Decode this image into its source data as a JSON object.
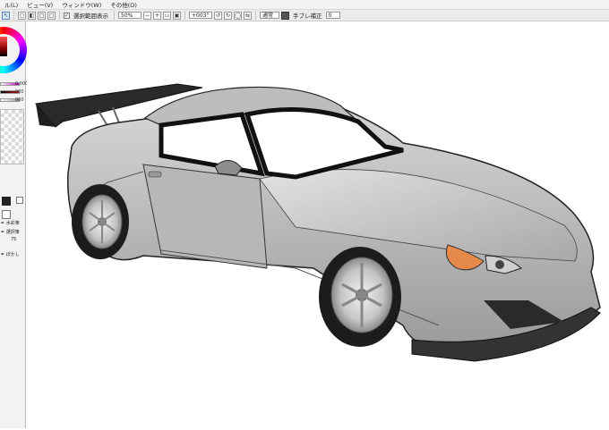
{
  "menu": {
    "items": [
      "ル(L)",
      "ビュー(V)",
      "ウィンドウ(W)",
      "その他(O)"
    ]
  },
  "toolbar": {
    "selection_display_label": "選択範囲表示",
    "zoom_value": "50%",
    "rotation_value": "+003°",
    "mode_label": "通常",
    "stabilizer_label": "手ブレ補正",
    "stabilizer_value": "0"
  },
  "left_panel": {
    "slider_values": [
      "0.000",
      "000",
      "060"
    ],
    "tool_labels": [
      "水彩筆",
      "選択筆",
      "ぼかし"
    ],
    "tool_value": "75"
  },
  "colors": {
    "accent_selected": "#d6e4f5",
    "panel_bg": "#f2f2f2",
    "canvas_bg": "#ffffff"
  }
}
